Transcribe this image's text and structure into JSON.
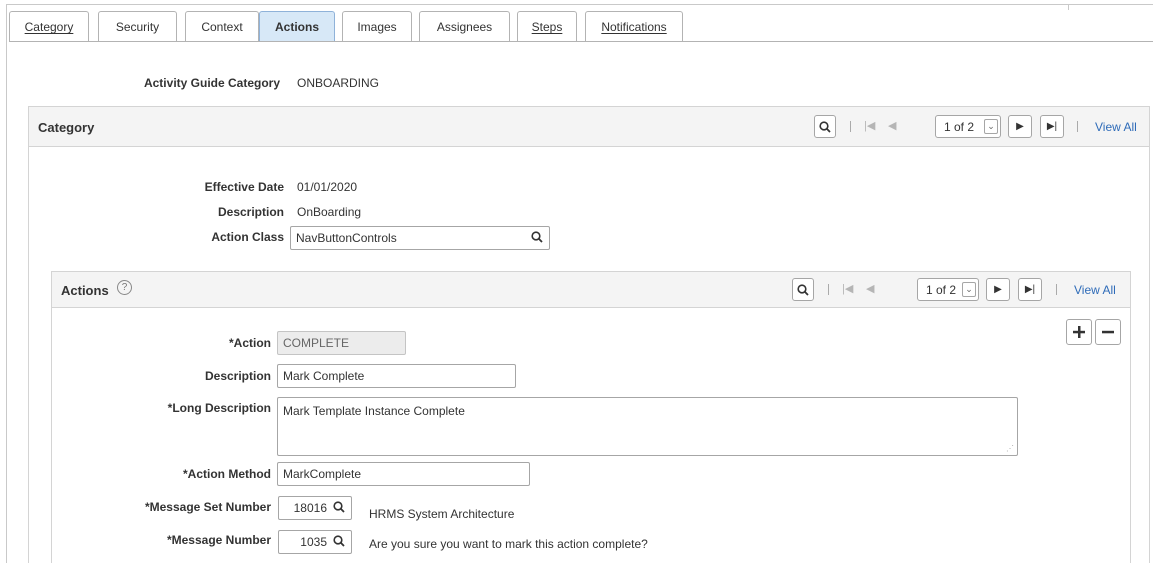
{
  "tabs": [
    {
      "label": "Category"
    },
    {
      "label": "Security"
    },
    {
      "label": "Context"
    },
    {
      "label": "Actions",
      "active": true
    },
    {
      "label": "Images"
    },
    {
      "label": "Assignees"
    },
    {
      "label": "Steps"
    },
    {
      "label": "Notifications"
    }
  ],
  "header": {
    "category_label": "Activity Guide Category",
    "category_value": "ONBOARDING"
  },
  "category_panel": {
    "title": "Category",
    "pager": "1 of 2",
    "view_all": "View All",
    "effective_date_label": "Effective Date",
    "effective_date_value": "01/01/2020",
    "description_label": "Description",
    "description_value": "OnBoarding",
    "action_class_label": "Action Class",
    "action_class_value": "NavButtonControls"
  },
  "actions_panel": {
    "title": "Actions",
    "help_icon": "question-circle-icon",
    "pager": "1 of 2",
    "view_all": "View All",
    "action_label": "*Action",
    "action_value": "COMPLETE",
    "description_label": "Description",
    "description_value": "Mark Complete",
    "long_description_label": "*Long Description",
    "long_description_value": "Mark Template Instance Complete",
    "action_method_label": "*Action Method",
    "action_method_value": "MarkComplete",
    "message_set_label": "*Message Set Number",
    "message_set_value": "18016",
    "message_set_desc": "HRMS System Architecture",
    "message_number_label": "*Message Number",
    "message_number_value": "1035",
    "message_number_desc": "Are you sure you want to mark this action complete?"
  },
  "colors": {
    "active_tab": "#d7e8f7",
    "link": "#2e6bb8",
    "panel_header": "#f4f4f4"
  }
}
